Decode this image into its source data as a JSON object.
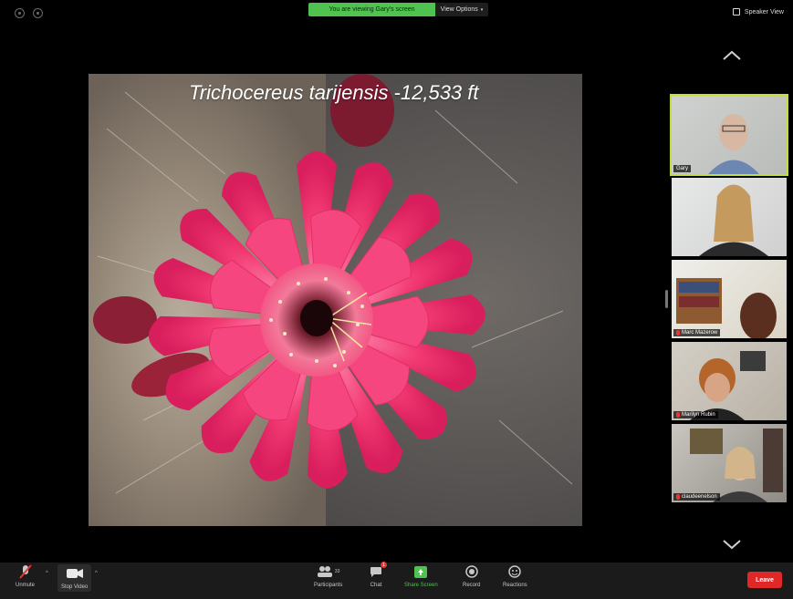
{
  "top_bar": {
    "viewing_banner": "You are viewing Gary's screen",
    "view_options": "View Options",
    "speaker_view": "Speaker View"
  },
  "slide": {
    "title": "Trichocereus tarijensis -12,533 ft"
  },
  "participants_strip": [
    {
      "name": "Gary",
      "muted": false,
      "active": true
    },
    {
      "name": "",
      "muted": false,
      "active": false
    },
    {
      "name": "Marc Mazerow",
      "muted": true,
      "active": false
    },
    {
      "name": "Marilyn Rubin",
      "muted": true,
      "active": false
    },
    {
      "name": "claudeenelson",
      "muted": true,
      "active": false
    }
  ],
  "toolbar": {
    "unmute": "Unmute",
    "stop_video": "Stop Video",
    "participants": "Participants",
    "participants_count": "33",
    "chat": "Chat",
    "chat_badge": "1",
    "share_screen": "Share Screen",
    "record": "Record",
    "reactions": "Reactions",
    "leave": "Leave"
  },
  "colors": {
    "share_green": "#4fc24f",
    "active_speaker": "#c6dd3b",
    "leave_red": "#e02828",
    "flower_pink": "#f0386e"
  },
  "icons": [
    "info-icon",
    "shield-icon",
    "grid-icon",
    "chevron-up-icon",
    "chevron-down-icon",
    "mic-muted-icon",
    "video-camera-icon",
    "participants-icon",
    "chat-icon",
    "share-screen-icon",
    "record-icon",
    "reactions-icon"
  ]
}
